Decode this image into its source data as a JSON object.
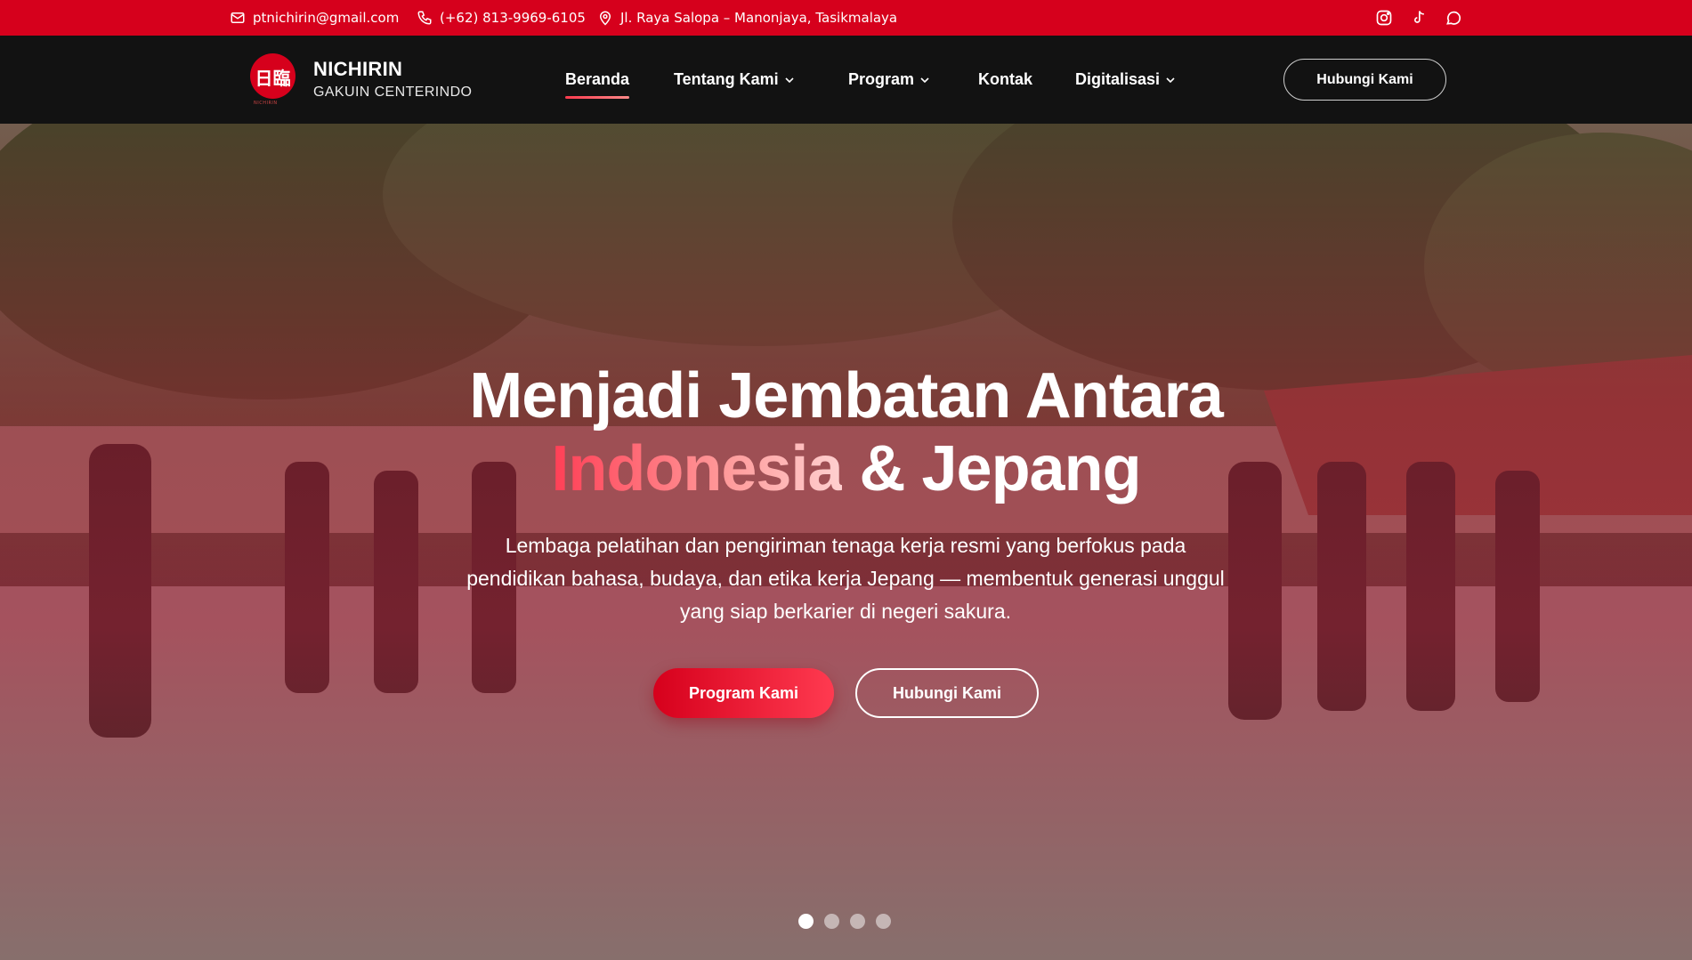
{
  "topbar": {
    "email": "ptnichirin@gmail.com",
    "phone": "(+62) 813-9969-6105",
    "address": "Jl. Raya Salopa – Manonjaya, Tasikmalaya",
    "socials": [
      "instagram-icon",
      "tiktok-icon",
      "whatsapp-icon"
    ],
    "bg_color": "#d6001c"
  },
  "brand": {
    "logo_kanji": "日臨",
    "logo_sub": "NICHIRIN",
    "title": "NICHIRIN",
    "subtitle": "GAKUIN CENTERINDO"
  },
  "nav": {
    "items": [
      {
        "label": "Beranda",
        "active": true
      },
      {
        "label": "Tentang Kami",
        "dropdown": true
      },
      {
        "label": "Program",
        "dropdown": true
      },
      {
        "label": "Kontak"
      },
      {
        "label": "Digitalisasi",
        "dropdown": true
      }
    ],
    "cta": "Hubungi Kami"
  },
  "hero": {
    "title_line1": "Menjadi Jembatan Antara",
    "title_highlight": "Indonesia",
    "title_rest": " & Jepang",
    "description": "Lembaga pelatihan dan pengiriman tenaga kerja resmi yang berfokus pada pendidikan bahasa, budaya, dan etika kerja Jepang — membentuk generasi unggul yang siap berkarier di negeri sakura.",
    "primary_button": "Program Kami",
    "secondary_button": "Hubungi Kami",
    "slides_total": 4,
    "slide_active": 1
  },
  "colors": {
    "accent": "#d6001c",
    "navbar": "#121212",
    "highlight_gradient": [
      "#ff3e55",
      "#ffd0d0"
    ]
  }
}
